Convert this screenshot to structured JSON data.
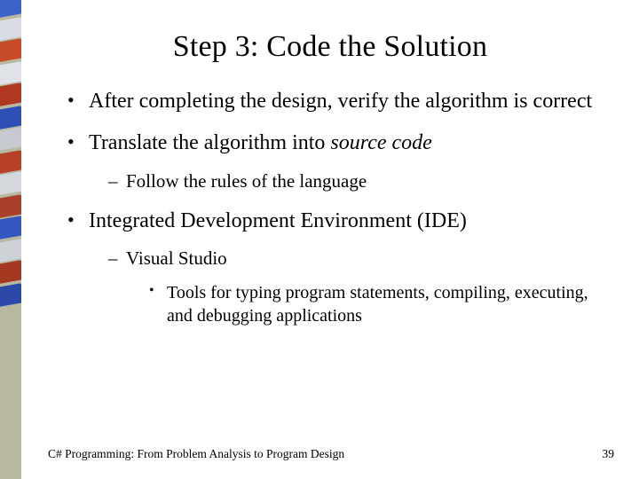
{
  "title": "Step 3: Code the Solution",
  "bullets": {
    "b0": {
      "text": "After completing the design, verify the algorithm is correct"
    },
    "b1": {
      "text_prefix": "Translate the algorithm into ",
      "italic": "source code",
      "sub": {
        "s0": "Follow the rules of the language"
      }
    },
    "b2": {
      "text": "Integrated Development Environment (IDE)",
      "sub": {
        "s0": {
          "text": "Visual Studio",
          "sub": {
            "t0": "Tools for typing program statements, compiling, executing, and debugging applications"
          }
        }
      }
    }
  },
  "footer": {
    "source": "C# Programming: From Problem Analysis to Program Design",
    "page": "39"
  }
}
